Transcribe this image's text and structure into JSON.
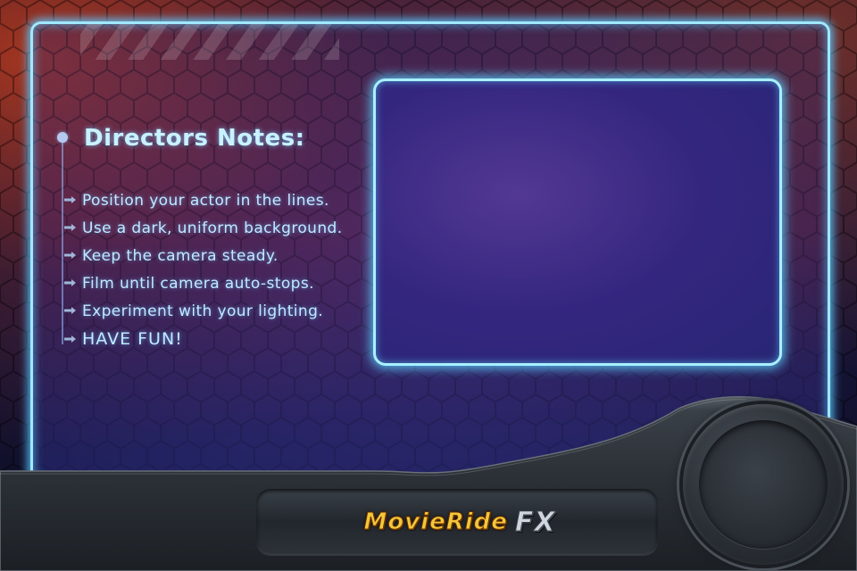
{
  "notes": {
    "title": "Directors Notes:",
    "items": [
      "Position your actor in the lines.",
      "Use a dark, uniform background.",
      "Keep the camera steady.",
      "Film until camera auto-stops.",
      "Experiment with your lighting.",
      "HAVE FUN!"
    ]
  },
  "logo": {
    "brand": "MovieRide",
    "fx": "FX"
  },
  "colors": {
    "glow": "#9fe8ff",
    "text": "#bfeaff",
    "logo_gold": "#f2c83a"
  },
  "icons": {
    "bullet": "arrow-bullet-icon",
    "record": "record-button"
  }
}
